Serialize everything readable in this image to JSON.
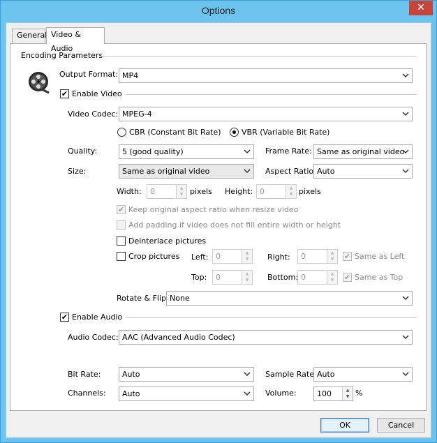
{
  "window": {
    "title": "Options",
    "close_glyph": "✕"
  },
  "tabs": [
    {
      "label": "General",
      "active": false
    },
    {
      "label": "Video & Audio",
      "active": true
    }
  ],
  "group": {
    "encoding_parameters": "Encoding Parameters"
  },
  "output_format": {
    "label": "Output Format:",
    "value": "MP4"
  },
  "enable_video": {
    "label": "Enable Video",
    "checked": true
  },
  "video_codec": {
    "label": "Video Codec:",
    "value": "MPEG-4"
  },
  "bitrate_mode": {
    "cbr": "CBR (Constant Bit Rate)",
    "vbr": "VBR (Variable Bit Rate)",
    "selected": "vbr"
  },
  "quality": {
    "label": "Quality:",
    "value": "5 (good quality)"
  },
  "frame_rate": {
    "label": "Frame Rate:",
    "value": "Same as original video"
  },
  "size": {
    "label": "Size:",
    "value": "Same as original video"
  },
  "aspect_ratio": {
    "label": "Aspect Ratio:",
    "value": "Auto"
  },
  "width": {
    "label": "Width:",
    "value": "0",
    "unit": "pixels"
  },
  "height": {
    "label": "Height:",
    "value": "0",
    "unit": "pixels"
  },
  "keep_aspect": {
    "label": "Keep original aspect ratio when resize video",
    "checked": true
  },
  "add_padding": {
    "label": "Add padding if video does not fill entire width or height",
    "checked": false
  },
  "deinterlace": {
    "label": "Deinterlace pictures",
    "checked": false
  },
  "crop": {
    "label": "Crop pictures",
    "checked": false,
    "left_label": "Left:",
    "left": "0",
    "right_label": "Right:",
    "right": "0",
    "top_label": "Top:",
    "top": "0",
    "bottom_label": "Bottom:",
    "bottom": "0",
    "same_as_left": "Same as Left",
    "same_as_top": "Same as Top"
  },
  "rotate_flip": {
    "label": "Rotate & Flip:",
    "value": "None"
  },
  "enable_audio": {
    "label": "Enable Audio",
    "checked": true
  },
  "audio_codec": {
    "label": "Audio Codec:",
    "value": "AAC (Advanced Audio Codec)"
  },
  "bit_rate": {
    "label": "Bit Rate:",
    "value": "Auto"
  },
  "sample_rate": {
    "label": "Sample Rate:",
    "value": "Auto"
  },
  "channels": {
    "label": "Channels:",
    "value": "Auto"
  },
  "volume": {
    "label": "Volume:",
    "value": "100",
    "unit": "%"
  },
  "buttons": {
    "ok": "OK",
    "cancel": "Cancel"
  },
  "icons": {
    "film_reel": "film-reel-icon",
    "dropdown": "chevron-down-icon"
  },
  "colors": {
    "titlebar": "#6cc4ee",
    "close": "#c7463c",
    "ok_border": "#3c7fb1"
  }
}
